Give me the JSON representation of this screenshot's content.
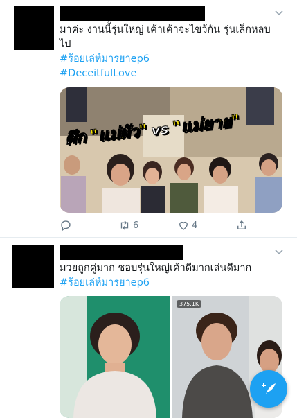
{
  "tweets": [
    {
      "text_line1": "มาค่ะ งานนี้รุ่นใหญ่ เค้าเค้าจะไขว้กัน รุ่นเล็กหลบ",
      "text_line2": "ไป",
      "hashtags": [
        "#ร้อยเล่ห์มารยาep6",
        "#DeceitfulLove"
      ],
      "media_caption": {
        "prefix": "ศึก",
        "left": "\"แม่ผัว\"",
        "vs": "vs",
        "right": "\"แม่ยาย\""
      },
      "actions": {
        "reply_count": "",
        "retweet_count": "6",
        "like_count": "4"
      }
    },
    {
      "text_line1": "มวยถูกคู่มาก ชอบรุ่นใหญ่เค้าดีมากเล่นดีมาก",
      "hashtags": [
        "#ร้อยเล่ห์มารยาep6"
      ],
      "media_badge": "375.1K"
    }
  ],
  "colors": {
    "link": "#1da1f2",
    "icon": "#657786",
    "fab": "#1da1f2",
    "text": "#14171a"
  },
  "icons": [
    "chevron-down-icon",
    "reply-icon",
    "retweet-icon",
    "heart-icon",
    "share-icon",
    "compose-tweet-icon"
  ]
}
